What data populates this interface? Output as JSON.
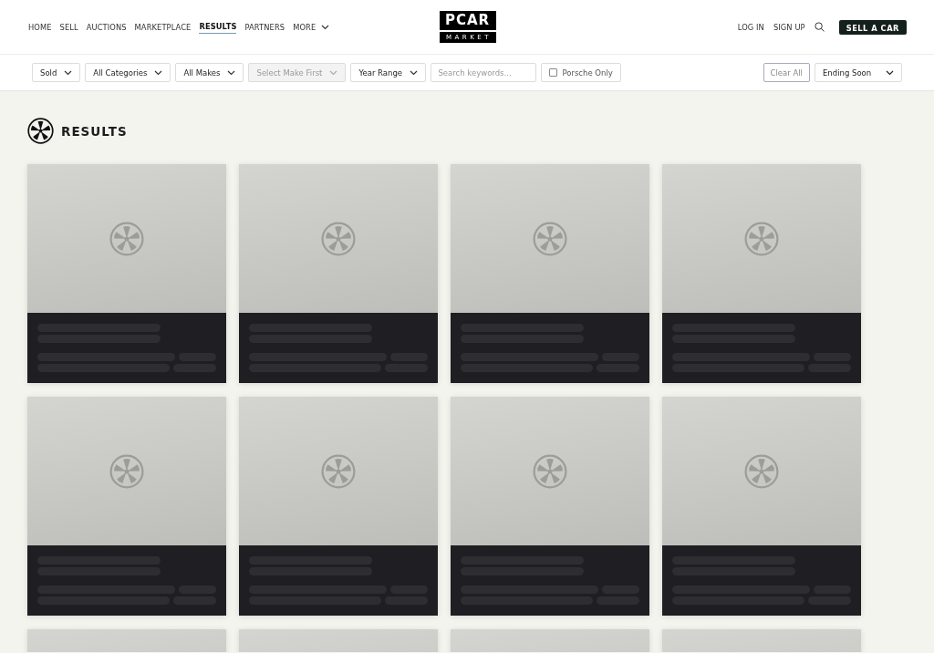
{
  "nav": [
    {
      "label": "HOME",
      "selected": false
    },
    {
      "label": "SELL",
      "selected": false
    },
    {
      "label": "AUCTIONS",
      "selected": false
    },
    {
      "label": "MARKETPLACE",
      "selected": false
    },
    {
      "label": "RESULTS",
      "selected": true
    },
    {
      "label": "PARTNERS",
      "selected": false
    },
    {
      "label": "MORE",
      "selected": false,
      "kind": "dropdown"
    }
  ],
  "logo": {
    "top": "PCAR",
    "bottom": "MARKET"
  },
  "account": [
    {
      "label": "LOG IN"
    },
    {
      "label": "SIGN UP"
    }
  ],
  "cta": "SELL A CAR",
  "filters": [
    {
      "kind": "select",
      "label": "Sold",
      "disabled": false
    },
    {
      "kind": "select",
      "label": "All Categories",
      "disabled": false
    },
    {
      "kind": "select",
      "label": "All Makes",
      "disabled": false
    },
    {
      "kind": "select",
      "label": "Select Make First",
      "disabled": true
    },
    {
      "kind": "select",
      "label": "Year Range",
      "disabled": false
    },
    {
      "kind": "search",
      "placeholder": "Search keywords..."
    },
    {
      "kind": "checkbox",
      "label": "Porsche Only",
      "checked": false
    }
  ],
  "clear_button": "Clear All",
  "sort": {
    "label": "Ending Soon"
  },
  "heading": "RESULTS",
  "cards": [
    {
      "kind": "skeleton"
    },
    {
      "kind": "skeleton"
    },
    {
      "kind": "skeleton"
    },
    {
      "kind": "skeleton"
    },
    {
      "kind": "skeleton"
    },
    {
      "kind": "skeleton"
    },
    {
      "kind": "skeleton"
    },
    {
      "kind": "skeleton"
    },
    {
      "kind": "skeleton_top"
    },
    {
      "kind": "skeleton_top"
    },
    {
      "kind": "skeleton_top"
    },
    {
      "kind": "skeleton_top"
    }
  ]
}
